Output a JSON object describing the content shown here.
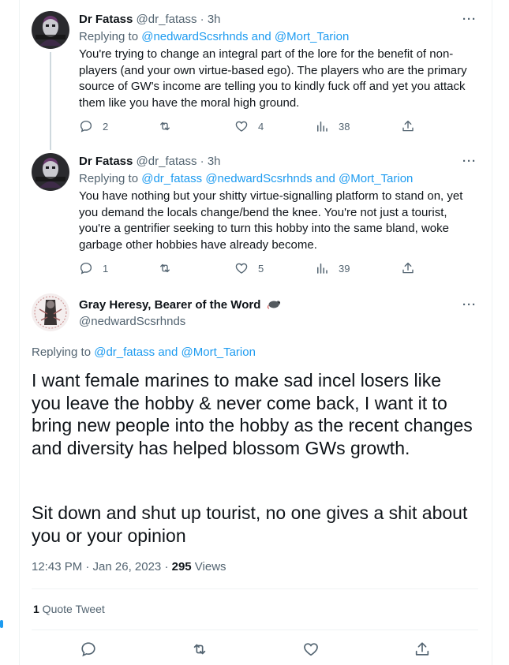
{
  "tweets": [
    {
      "name": "Dr Fatass",
      "handle": "@dr_fatass",
      "time": "3h",
      "more": "···",
      "replying_prefix": "Replying to ",
      "replying_users": "@nedwardScsrhnds and @Mort_Tarion",
      "text": "You're trying to change an integral part of the lore for the benefit of non-players (and your own virtue-based ego). The players who are the primary source of GW's income are telling you to kindly fuck off and yet you attack them like you have the moral high ground.",
      "replies": "2",
      "retweets": "",
      "likes": "4",
      "views": "38"
    },
    {
      "name": "Dr Fatass",
      "handle": "@dr_fatass",
      "time": "3h",
      "more": "···",
      "replying_prefix": "Replying to ",
      "replying_users": "@dr_fatass @nedwardScsrhnds and @Mort_Tarion",
      "text": "You have nothing but your shitty virtue-signalling platform to stand on, yet you demand the locals change/bend the knee. You're not just a tourist, you're a gentrifier seeking to turn this hobby into the same bland, woke garbage other hobbies have already become.",
      "replies": "1",
      "retweets": "",
      "likes": "5",
      "views": "39"
    }
  ],
  "main_tweet": {
    "name": "Gray Heresy, Bearer of the Word",
    "handle": "@nedwardScsrhnds",
    "more": "···",
    "replying_prefix": "Replying to ",
    "replying_users": "@dr_fatass and @Mort_Tarion",
    "paragraph1": "I want female marines to make sad incel losers like you leave the hobby & never come back, I want it to bring new people into the hobby as the recent changes and diversity has helped blossom GWs growth.",
    "paragraph2": "Sit down and shut up tourist, no one gives a shit about you or your opinion",
    "timestamp": "12:43 PM · Jan 26, 2023 · ",
    "views_count": "295",
    "views_label": " Views",
    "quote_count": "1",
    "quote_label": " Quote Tweet"
  },
  "colors": {
    "accent": "#1d9bf0",
    "muted": "#536471",
    "text": "#0f1419",
    "border": "#eff3f4"
  }
}
